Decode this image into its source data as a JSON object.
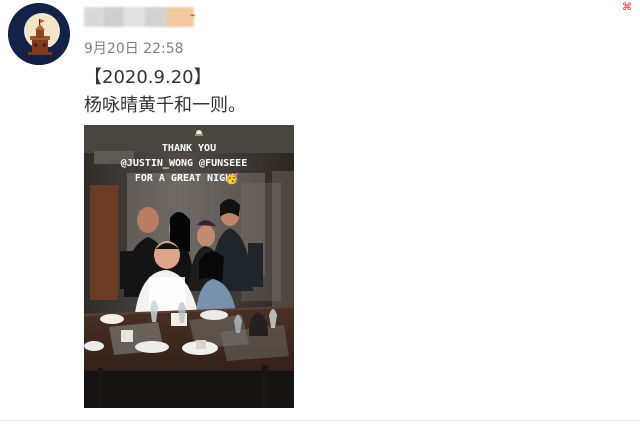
{
  "post": {
    "timestamp": "9月20日 22:58",
    "lines": [
      "【2020.9.20】",
      "杨咏晴黄千和一则。"
    ]
  },
  "photo": {
    "caption_lines": [
      "THANK YOU",
      "@JUSTIN_WONG @FUNSEEE",
      "FOR A GREAT NIGHT"
    ],
    "emoji": "🥳"
  },
  "colors": {
    "text": "#333333",
    "muted": "#808080",
    "accent": "#e0302a"
  },
  "icons": {
    "avatar": "castle-moon-icon",
    "corner": "weibo-mark-icon",
    "badge": "vip-badge-icon"
  }
}
